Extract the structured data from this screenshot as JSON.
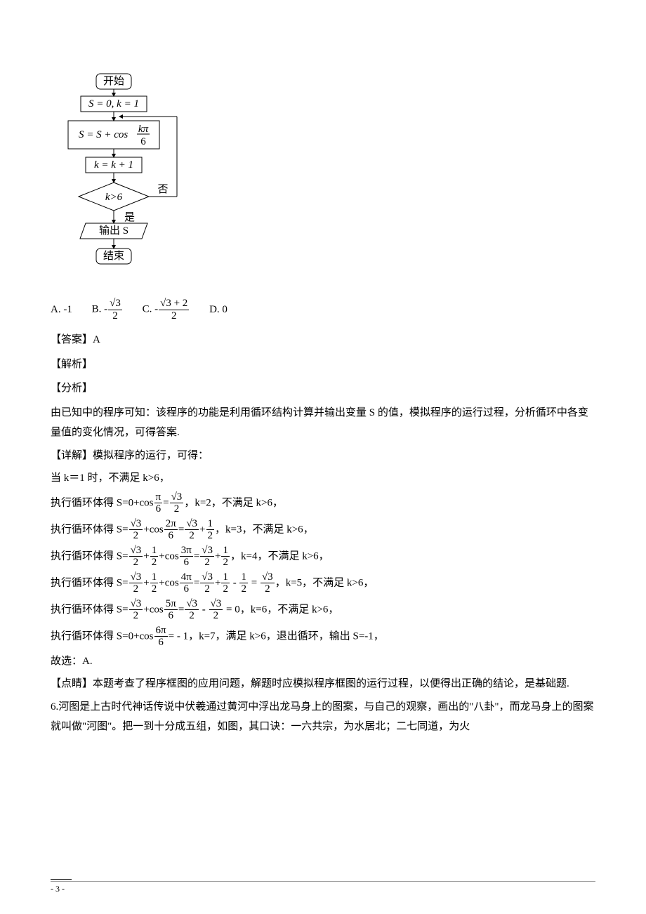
{
  "flow": {
    "start": "开始",
    "init": "S = 0, k = 1",
    "step1": "S = S + cos",
    "step1_frac_num": "kπ",
    "step1_frac_den": "6",
    "step2": "k = k + 1",
    "cond": "k>6",
    "no": "否",
    "yes": "是",
    "out": "输出 S",
    "end": "结束"
  },
  "options": {
    "a_label": "A. ",
    "a_val": "-1",
    "b_label": "B. ",
    "b_num": "√3",
    "b_den": "2",
    "c_label": "C. ",
    "c_num": "√3 + 2",
    "c_den": "2",
    "d_label": "D. ",
    "d_val": "0",
    "neg": "-"
  },
  "answer_label": "【答案】A",
  "jiexi_label": "【解析】",
  "fenxi_label": "【分析】",
  "fenxi_text": "由已知中的程序可知：该程序的功能是利用循环结构计算并输出变量 S 的值，模拟程序的运行过程，分析循环中各变量值的变化情况，可得答案.",
  "xiangjie_label": "【详解】模拟程序的运行，可得：",
  "step_k1": "当 k＝1 时，不满足 k>6，",
  "loop_prefix": "执行循环体得 S=",
  "l1": {
    "a": "0+cos",
    "f1n": "π",
    "f1d": "6",
    "eq": "=",
    "r1n": "√3",
    "r1d": "2",
    "tail": "，k=2，不满足 k>6，"
  },
  "l2": {
    "t1n": "√3",
    "t1d": "2",
    "p": "+cos",
    "f1n": "2π",
    "f1d": "6",
    "eq": "=",
    "r1n": "√3",
    "r1d": "2",
    "p2": "+",
    "r2n": "1",
    "r2d": "2",
    "tail": "，k=3，不满足 k>6，"
  },
  "l3": {
    "t1n": "√3",
    "t1d": "2",
    "p0": "+",
    "t2n": "1",
    "t2d": "2",
    "p": "+cos",
    "f1n": "3π",
    "f1d": "6",
    "eq": "=",
    "r1n": "√3",
    "r1d": "2",
    "p2": "+",
    "r2n": "1",
    "r2d": "2",
    "tail": "，k=4，不满足 k>6，"
  },
  "l4": {
    "t1n": "√3",
    "t1d": "2",
    "p0": "+",
    "t2n": "1",
    "t2d": "2",
    "p": "+cos",
    "f1n": "4π",
    "f1d": "6",
    "eq": "=",
    "r1n": "√3",
    "r1d": "2",
    "p2": "+",
    "r2n": "1",
    "r2d": "2",
    "m": " - ",
    "r3n": "1",
    "r3d": "2",
    "eq2": " = ",
    "r4n": "√3",
    "r4d": "2",
    "tail": "，k=5，不满足 k>6，"
  },
  "l5": {
    "t1n": "√3",
    "t1d": "2",
    "p": "+cos",
    "f1n": "5π",
    "f1d": "6",
    "eq": "=",
    "r1n": "√3",
    "r1d": "2",
    "m": " - ",
    "r2n": "√3",
    "r2d": "2",
    "eq2": " = 0",
    "tail": "，k=6，不满足 k>6，"
  },
  "l6": {
    "a": "0+cos",
    "f1n": "6π",
    "f1d": "6",
    "eq": "= - 1",
    "tail": "，k=7，满足 k>6，退出循环，输出 S=-1，"
  },
  "guxuan": "故选：A.",
  "dianjing": "【点睛】本题考查了程序框图的应用问题，解题时应模拟程序框图的运行过程，以便得出正确的结论，是基础题.",
  "q6_text": "6.河图是上古时代神话传说中伏羲通过黄河中浮出龙马身上的图案，与自己的观察，画出的\"八卦\"，而龙马身上的图案就叫做\"河图\"。把一到十分成五组，如图，其口诀：一六共宗，为水居北；二七同道，为火",
  "page_num": "- 3 -"
}
